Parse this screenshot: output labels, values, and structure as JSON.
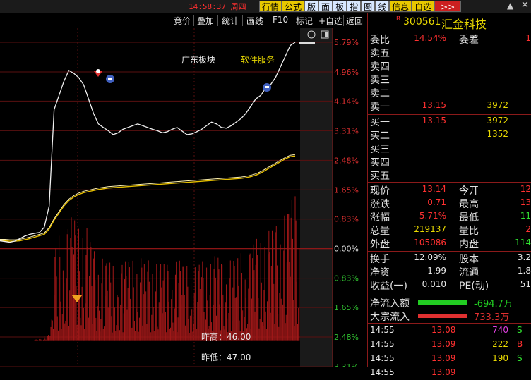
{
  "topbar": {
    "clock": "14:58:37",
    "weekday": "周四",
    "menu": [
      "行情",
      "公式",
      "版",
      "面",
      "板",
      "指",
      "图",
      "线",
      "信息",
      "自选",
      ">>"
    ]
  },
  "toolbar": {
    "items": [
      "竞价",
      "叠加",
      "统计",
      "画线",
      "F10",
      "标记",
      "+自选",
      "返回"
    ]
  },
  "chart": {
    "label_region": "广东板块",
    "label_sector": "软件服务",
    "label_high": "昨高：46.00",
    "label_low": "昨低：47.00",
    "pct_ticks_up": [
      "5.79%",
      "4.96%",
      "4.14%",
      "3.31%",
      "2.48%",
      "1.65%",
      "0.83%"
    ],
    "pct_zero": "0.00%",
    "pct_ticks_down": [
      "0.83%",
      "1.65%",
      "2.48%",
      "3.31%"
    ]
  },
  "chart_data": {
    "type": "line",
    "price_pct": [
      0.22,
      0.2,
      0.18,
      0.21,
      0.28,
      0.35,
      0.4,
      0.43,
      0.45,
      0.6,
      1.2,
      3.9,
      4.3,
      4.7,
      5.0,
      4.92,
      4.8,
      4.6,
      4.2,
      3.8,
      3.5,
      3.4,
      3.31,
      3.2,
      3.25,
      3.35,
      3.4,
      3.45,
      3.5,
      3.45,
      3.4,
      3.35,
      3.31,
      3.25,
      3.28,
      3.35,
      3.4,
      3.3,
      3.2,
      3.22,
      3.28,
      3.35,
      3.45,
      3.55,
      3.5,
      3.4,
      3.38,
      3.45,
      3.55,
      3.65,
      3.8,
      4.0,
      4.2,
      4.3,
      4.5,
      4.6,
      4.8,
      5.1,
      5.4,
      5.7,
      5.79
    ],
    "avg_pct": [
      0.22,
      0.22,
      0.21,
      0.21,
      0.22,
      0.25,
      0.28,
      0.32,
      0.36,
      0.4,
      0.55,
      0.8,
      1.0,
      1.2,
      1.35,
      1.45,
      1.52,
      1.57,
      1.6,
      1.63,
      1.66,
      1.68,
      1.7,
      1.71,
      1.72,
      1.73,
      1.74,
      1.75,
      1.76,
      1.77,
      1.78,
      1.79,
      1.8,
      1.81,
      1.82,
      1.83,
      1.84,
      1.85,
      1.86,
      1.87,
      1.88,
      1.89,
      1.9,
      1.91,
      1.92,
      1.93,
      1.94,
      1.95,
      1.96,
      1.97,
      1.99,
      2.02,
      2.06,
      2.12,
      2.2,
      2.28,
      2.36,
      2.44,
      2.52,
      2.58,
      2.6
    ],
    "ylim": [
      -3.31,
      5.79
    ]
  },
  "quote": {
    "code": "300561",
    "name": "汇金科技",
    "weibi_label": "委比",
    "weibi": "14.54%",
    "weicha_label": "委差",
    "weicha": "1",
    "sell": [
      {
        "label": "卖五",
        "price": "",
        "vol": ""
      },
      {
        "label": "卖四",
        "price": "",
        "vol": ""
      },
      {
        "label": "卖三",
        "price": "",
        "vol": ""
      },
      {
        "label": "卖二",
        "price": "",
        "vol": ""
      },
      {
        "label": "卖一",
        "price": "13.15",
        "vol": "3972"
      }
    ],
    "buy": [
      {
        "label": "买一",
        "price": "13.15",
        "vol": "3972"
      },
      {
        "label": "买二",
        "price": "",
        "vol": "1352"
      },
      {
        "label": "买三",
        "price": "",
        "vol": ""
      },
      {
        "label": "买四",
        "price": "",
        "vol": ""
      },
      {
        "label": "买五",
        "price": "",
        "vol": ""
      }
    ],
    "stats": [
      {
        "l1": "现价",
        "v1": "13.14",
        "l2": "今开",
        "v2": "12",
        "c1": "#ff3030",
        "c2": "#ff3030"
      },
      {
        "l1": "涨跌",
        "v1": "0.71",
        "l2": "最高",
        "v2": "13",
        "c1": "#ff3030",
        "c2": "#ff3030"
      },
      {
        "l1": "涨幅",
        "v1": "5.71%",
        "l2": "最低",
        "v2": "11",
        "c1": "#ff3030",
        "c2": "#30e030"
      },
      {
        "l1": "总量",
        "v1": "219137",
        "l2": "量比",
        "v2": "2",
        "c1": "#e8d800",
        "c2": "#ff3030"
      },
      {
        "l1": "外盘",
        "v1": "105086",
        "l2": "内盘",
        "v2": "114",
        "c1": "#ff3030",
        "c2": "#30e030"
      }
    ],
    "stats2": [
      {
        "l1": "换手",
        "v1": "12.09%",
        "l2": "股本",
        "v2": "3.2"
      },
      {
        "l1": "净资",
        "v1": "1.99",
        "l2": "流通",
        "v2": "1.8"
      },
      {
        "l1": "收益(一)",
        "v1": "0.010",
        "l2": "PE(动)",
        "v2": "51"
      }
    ],
    "flow": [
      {
        "label": "净流入额",
        "value": "-694.7万",
        "color": "#22cc22"
      },
      {
        "label": "大宗流入",
        "value": "733.3万",
        "color": "#e03030"
      }
    ],
    "ticks": [
      {
        "time": "14:55",
        "price": "13.08",
        "vol": "740",
        "bs": "S",
        "vc": "#e040e0",
        "bc": "#30e030"
      },
      {
        "time": "14:55",
        "price": "13.09",
        "vol": "222",
        "bs": "B",
        "vc": "#e8d800",
        "bc": "#ff3030"
      },
      {
        "time": "14:55",
        "price": "13.09",
        "vol": "190",
        "bs": "S",
        "vc": "#e8d800",
        "bc": "#30e030"
      },
      {
        "time": "14:55",
        "price": "13.09",
        "vol": "",
        "bs": "",
        "vc": "#e8d800",
        "bc": "#30e030"
      }
    ]
  }
}
